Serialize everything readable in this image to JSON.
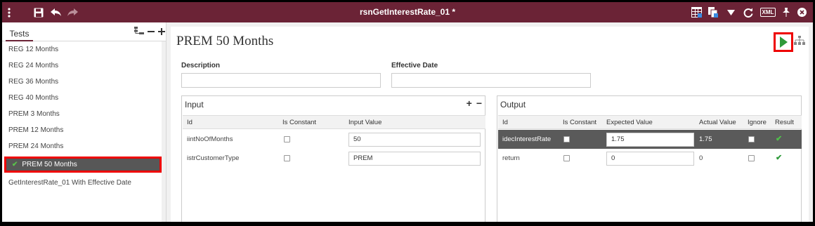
{
  "window": {
    "title": "rsnGetInterestRate_01 *"
  },
  "topbar": {
    "menu_icon": "kebab-menu-icon",
    "save_icon": "save-icon",
    "undo_icon": "undo-icon",
    "redo_icon": "redo-icon",
    "grid_icon": "grid-view-icon",
    "copy_icon": "copy-icon",
    "dropdown_icon": "triangle-down-icon",
    "refresh_icon": "refresh-icon",
    "xml_label": "XML",
    "pin_icon": "pin-icon",
    "close_icon": "close-circle-icon"
  },
  "sidebar": {
    "tab_label": "Tests",
    "items": [
      {
        "label": "REG 12 Months"
      },
      {
        "label": "REG 24 Months"
      },
      {
        "label": "REG 36 Months"
      },
      {
        "label": "REG 40 Months"
      },
      {
        "label": "PREM 3 Months"
      },
      {
        "label": "PREM 12 Months"
      },
      {
        "label": "PREM 24 Months"
      },
      {
        "label": "PREM 50 Months",
        "active": true
      },
      {
        "label": "GetInterestRate_01  With Effective Date"
      }
    ]
  },
  "main": {
    "title": "PREM 50 Months",
    "description_label": "Description",
    "description_value": "",
    "effective_date_label": "Effective Date",
    "effective_date_value": "",
    "input": {
      "title": "Input",
      "columns": [
        "Id",
        "Is Constant",
        "Input Value"
      ],
      "rows": [
        {
          "id": "iintNoOfMonths",
          "is_constant": false,
          "value": "50"
        },
        {
          "id": "istrCustomerType",
          "is_constant": false,
          "value": "PREM"
        }
      ]
    },
    "output": {
      "title": "Output",
      "columns": [
        "Id",
        "Is Constant",
        "Expected Value",
        "Actual Value",
        "Ignore",
        "Result"
      ],
      "rows": [
        {
          "id": "idecInterestRate",
          "is_constant": false,
          "expected": "1.75",
          "actual": "1.75",
          "ignore": false,
          "result": "pass",
          "selected": true
        },
        {
          "id": "return",
          "is_constant": false,
          "expected": "0",
          "actual": "0",
          "ignore": false,
          "result": "pass",
          "selected": false
        }
      ]
    }
  },
  "colors": {
    "brand": "#6b2336",
    "highlight": "#ff0000",
    "pass": "#2e9a3a",
    "selected_row": "#5a5a5a"
  }
}
